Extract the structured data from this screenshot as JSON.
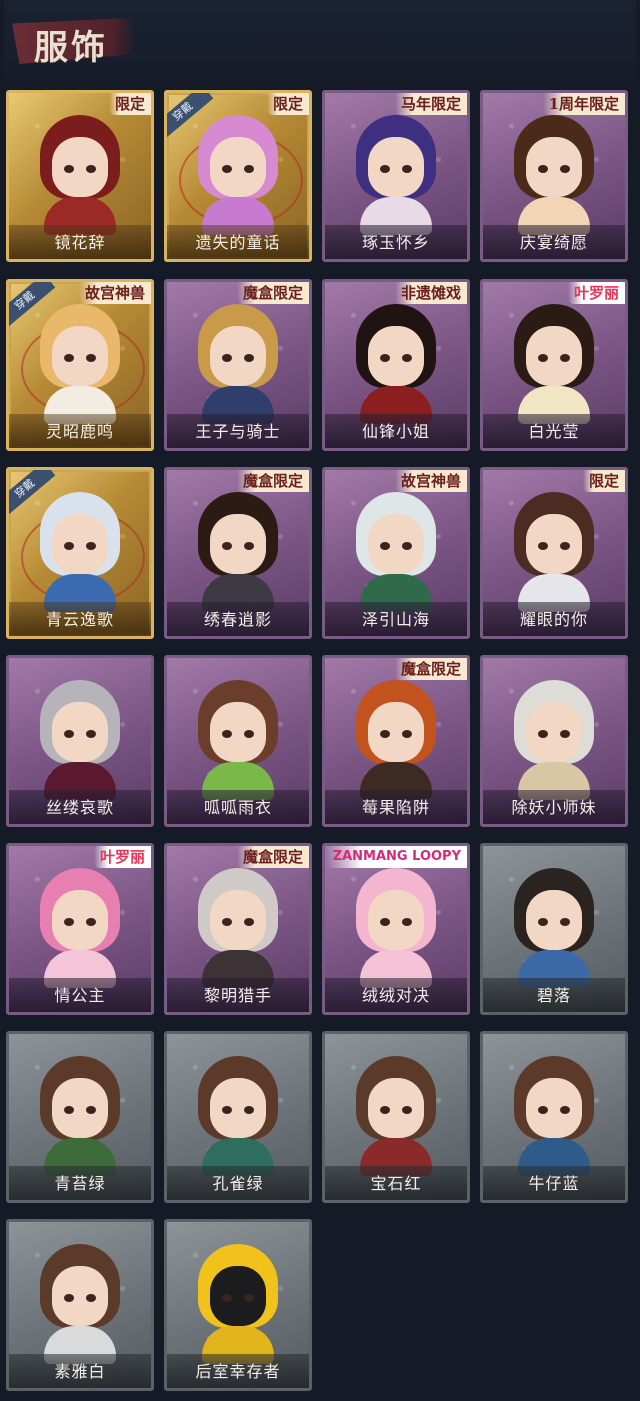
{
  "header": {
    "title": "服饰"
  },
  "colors": {
    "background": "#141a26",
    "tier_gold": "#d9b35e",
    "tier_purple": "#7c5685",
    "tier_grey": "#6c7378"
  },
  "items": [
    {
      "name": "镜花辞",
      "tier": "gold",
      "badge": "限定",
      "worn": false,
      "hair": "#7c1d1d",
      "outfit": "#9b2a26"
    },
    {
      "name": "遗失的童话",
      "tier": "gold",
      "badge": "限定",
      "worn": true,
      "worn_label": "穿戴",
      "hair": "#d78ad2",
      "outfit": "#c67bd0"
    },
    {
      "name": "琢玉怀乡",
      "tier": "purple",
      "badge": "马年限定",
      "worn": false,
      "hair": "#3e2f80",
      "outfit": "#e8dbe7"
    },
    {
      "name": "庆宴绮愿",
      "tier": "purple",
      "badge": "1周年限定",
      "worn": false,
      "hair": "#4a2b1a",
      "outfit": "#f2d5b4"
    },
    {
      "name": "灵昭鹿鸣",
      "tier": "gold",
      "badge": "故宫神兽",
      "worn": true,
      "worn_label": "穿戴",
      "hair": "#e9b86a",
      "outfit": "#f3ece2"
    },
    {
      "name": "王子与骑士",
      "tier": "purple",
      "badge": "魔盒限定",
      "worn": false,
      "hair": "#c89a4a",
      "outfit": "#2f3e6a"
    },
    {
      "name": "仙锋小姐",
      "tier": "purple",
      "badge": "非遗傩戏",
      "worn": false,
      "hair": "#1f1412",
      "outfit": "#8b1f1f"
    },
    {
      "name": "白光莹",
      "tier": "purple",
      "badge": "叶罗丽",
      "badge_style": "pink",
      "worn": false,
      "hair": "#2a1c15",
      "outfit": "#f0e6c4"
    },
    {
      "name": "青云逸歌",
      "tier": "gold",
      "badge": "",
      "worn": true,
      "worn_label": "穿戴",
      "hair": "#d9e1ec",
      "outfit": "#3a6ab0"
    },
    {
      "name": "绣春逍影",
      "tier": "purple",
      "badge": "魔盒限定",
      "worn": false,
      "hair": "#2b1b14",
      "outfit": "#3d3a44"
    },
    {
      "name": "泽引山海",
      "tier": "purple",
      "badge": "故宫神兽",
      "worn": false,
      "hair": "#dfe6e8",
      "outfit": "#2f6b4a"
    },
    {
      "name": "耀眼的你",
      "tier": "purple",
      "badge": "限定",
      "worn": false,
      "hair": "#4a2c22",
      "outfit": "#e6e6ea"
    },
    {
      "name": "丝缕哀歌",
      "tier": "purple",
      "badge": "",
      "worn": false,
      "hair": "#b7b3bb",
      "outfit": "#5b1930"
    },
    {
      "name": "呱呱雨衣",
      "tier": "purple",
      "badge": "",
      "worn": false,
      "hair": "#6a3e2a",
      "outfit": "#7ab84a"
    },
    {
      "name": "莓果陷阱",
      "tier": "purple",
      "badge": "魔盒限定",
      "worn": false,
      "hair": "#c2521e",
      "outfit": "#3d2a22"
    },
    {
      "name": "除妖小师妹",
      "tier": "purple",
      "badge": "",
      "worn": false,
      "hair": "#dedcd6",
      "outfit": "#d9c6a4"
    },
    {
      "name": "情公主",
      "tier": "purple",
      "badge": "叶罗丽",
      "badge_style": "pink",
      "worn": false,
      "hair": "#e77fb0",
      "outfit": "#f4c5d9"
    },
    {
      "name": "黎明猎手",
      "tier": "purple",
      "badge": "魔盒限定",
      "worn": false,
      "hair": "#cfcac7",
      "outfit": "#3d3235"
    },
    {
      "name": "绒绒对决",
      "tier": "purple",
      "badge": "ZANMANG LOOPY",
      "badge_style": "white",
      "worn": false,
      "hair": "#f3b5cf",
      "outfit": "#f5c2d6"
    },
    {
      "name": "碧落",
      "tier": "grey",
      "badge": "",
      "worn": false,
      "hair": "#2a2320",
      "outfit": "#3c6aa6"
    },
    {
      "name": "青苔绿",
      "tier": "grey",
      "badge": "",
      "worn": false,
      "hair": "#5c3a2a",
      "outfit": "#3d6b3a"
    },
    {
      "name": "孔雀绿",
      "tier": "grey",
      "badge": "",
      "worn": false,
      "hair": "#5c3a2a",
      "outfit": "#2e6e5e"
    },
    {
      "name": "宝石红",
      "tier": "grey",
      "badge": "",
      "worn": false,
      "hair": "#5c3a2a",
      "outfit": "#8a2a2a"
    },
    {
      "name": "牛仔蓝",
      "tier": "grey",
      "badge": "",
      "worn": false,
      "hair": "#5c3a2a",
      "outfit": "#2f5b8a"
    },
    {
      "name": "素雅白",
      "tier": "grey",
      "badge": "",
      "worn": false,
      "hair": "#5c3a2a",
      "outfit": "#d9dadb"
    },
    {
      "name": "后室幸存者",
      "tier": "grey",
      "badge": "",
      "worn": false,
      "hair": "#f1c21b",
      "outfit": "#e2b51c"
    }
  ]
}
